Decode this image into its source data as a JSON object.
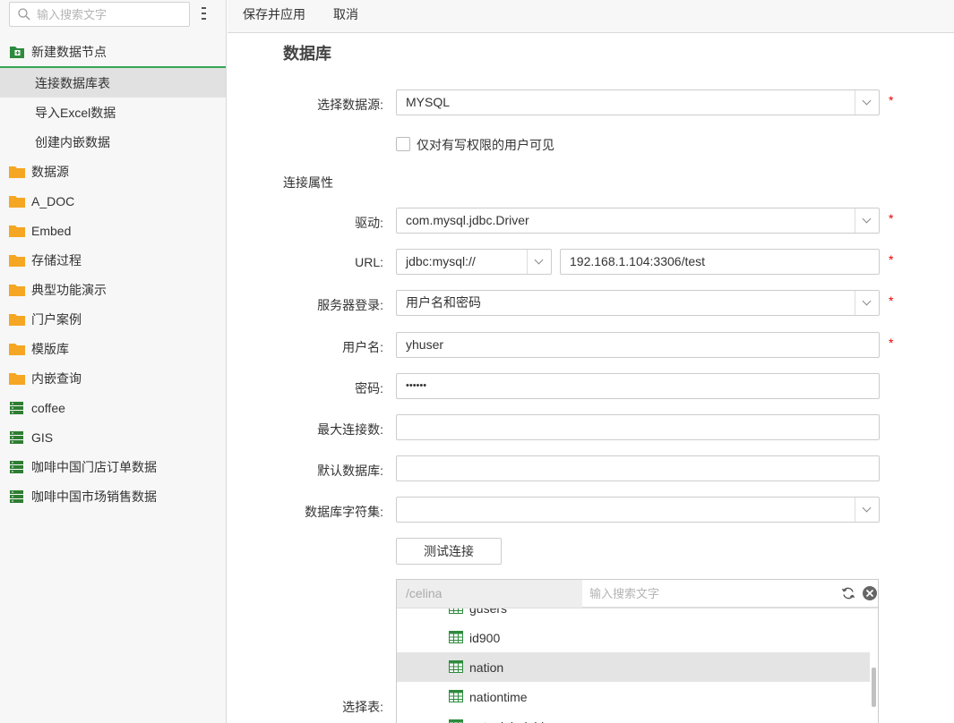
{
  "sidebar": {
    "search_placeholder": "输入搜索文字",
    "root_label": "新建数据节点",
    "children": [
      "连接数据库表",
      "导入Excel数据",
      "创建内嵌数据"
    ],
    "folders": [
      "数据源",
      "A_DOC",
      "Embed",
      "存储过程",
      "典型功能演示",
      "门户案例",
      "模版库",
      "内嵌查询"
    ],
    "datasets": [
      "coffee",
      "GIS",
      "咖啡中国门店订单数据",
      "咖啡中国市场销售数据"
    ]
  },
  "toolbar": {
    "save_apply": "保存并应用",
    "cancel": "取消"
  },
  "form": {
    "title": "数据库",
    "datasource_label": "选择数据源:",
    "datasource_value": "MYSQL",
    "writable_only_label": "仅对有写权限的用户可见",
    "section_title": "连接属性",
    "driver_label": "驱动:",
    "driver_value": "com.mysql.jdbc.Driver",
    "url_label": "URL:",
    "url_prefix": "jdbc:mysql://",
    "url_value": "192.168.1.104:3306/test",
    "login_label": "服务器登录:",
    "login_value": "用户名和密码",
    "user_label": "用户名:",
    "user_value": "yhuser",
    "password_label": "密码:",
    "password_value": "••••••",
    "maxconn_label": "最大连接数:",
    "maxconn_value": "",
    "defaultdb_label": "默认数据库:",
    "defaultdb_value": "",
    "charset_label": "数据库字符集:",
    "charset_value": "",
    "test_button": "测试连接",
    "required_mark": "*",
    "table_label": "选择表:"
  },
  "chooser": {
    "path": "/celina",
    "search_placeholder": "输入搜索文字",
    "items": [
      "gusers",
      "id900",
      "nation",
      "nationtime",
      "natunlabel_bi"
    ],
    "selected": "nation"
  },
  "colors": {
    "accent_green": "#34a853",
    "folder_orange": "#f5a623",
    "required_red": "#e60000"
  }
}
